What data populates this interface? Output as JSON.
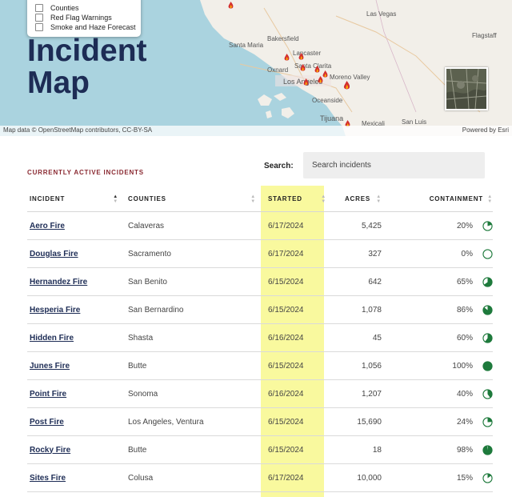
{
  "map": {
    "layers": [
      {
        "label": "Counties"
      },
      {
        "label": "Red Flag Warnings"
      },
      {
        "label": "Smoke and Haze Forecast"
      }
    ],
    "title_line1": "Incident",
    "title_line2": "Map",
    "places": {
      "las_vegas": "Las Vegas",
      "bakersfield": "Bakersfield",
      "flagstaff": "Flagstaff",
      "santa_maria": "Santa Maria",
      "lancaster": "Lancaster",
      "santa_clarita": "Santa Clarita",
      "oxnard": "Oxnard",
      "los_angeles": "Los Angeles",
      "moreno_valley": "Moreno Valley",
      "oceanside": "Oceanside",
      "tijuana": "Tijuana",
      "san_luis": "San Luis",
      "mexicali": "Mexicali"
    },
    "attribution_left": "Map data © OpenStreetMap contributors, CC-BY-SA",
    "attribution_right": "Powered by Esri",
    "colors": {
      "water": "#aad3df",
      "land": "#f2efe9",
      "fire": "#d32f2f"
    }
  },
  "table_section": {
    "label": "CURRENTLY ACTIVE INCIDENTS",
    "search_label": "Search:",
    "search_placeholder": "Search incidents",
    "headers": {
      "incident": "INCIDENT",
      "counties": "COUNTIES",
      "started": "STARTED",
      "acres": "ACRES",
      "containment": "CONTAINMENT"
    },
    "rows": [
      {
        "incident": "Aero Fire",
        "counties": "Calaveras",
        "started": "6/17/2024",
        "acres": "5,425",
        "containment": "20%",
        "containment_value": 20
      },
      {
        "incident": "Douglas Fire",
        "counties": "Sacramento",
        "started": "6/17/2024",
        "acres": "327",
        "containment": "0%",
        "containment_value": 0
      },
      {
        "incident": "Hernandez Fire",
        "counties": "San Benito",
        "started": "6/15/2024",
        "acres": "642",
        "containment": "65%",
        "containment_value": 65
      },
      {
        "incident": "Hesperia Fire",
        "counties": "San Bernardino",
        "started": "6/15/2024",
        "acres": "1,078",
        "containment": "86%",
        "containment_value": 86
      },
      {
        "incident": "Hidden Fire",
        "counties": "Shasta",
        "started": "6/16/2024",
        "acres": "45",
        "containment": "60%",
        "containment_value": 60
      },
      {
        "incident": "Junes Fire",
        "counties": "Butte",
        "started": "6/15/2024",
        "acres": "1,056",
        "containment": "100%",
        "containment_value": 100
      },
      {
        "incident": "Point Fire",
        "counties": "Sonoma",
        "started": "6/16/2024",
        "acres": "1,207",
        "containment": "40%",
        "containment_value": 40
      },
      {
        "incident": "Post Fire",
        "counties": "Los Angeles, Ventura",
        "started": "6/15/2024",
        "acres": "15,690",
        "containment": "24%",
        "containment_value": 24
      },
      {
        "incident": "Rocky Fire",
        "counties": "Butte",
        "started": "6/15/2024",
        "acres": "18",
        "containment": "98%",
        "containment_value": 98
      },
      {
        "incident": "Sites Fire",
        "counties": "Colusa",
        "started": "6/17/2024",
        "acres": "10,000",
        "containment": "15%",
        "containment_value": 15
      }
    ],
    "colors": {
      "accent": "#8a2a32",
      "link": "#1d2c55",
      "highlight": "#f9f99e",
      "pie": "#1e7a3c"
    }
  }
}
